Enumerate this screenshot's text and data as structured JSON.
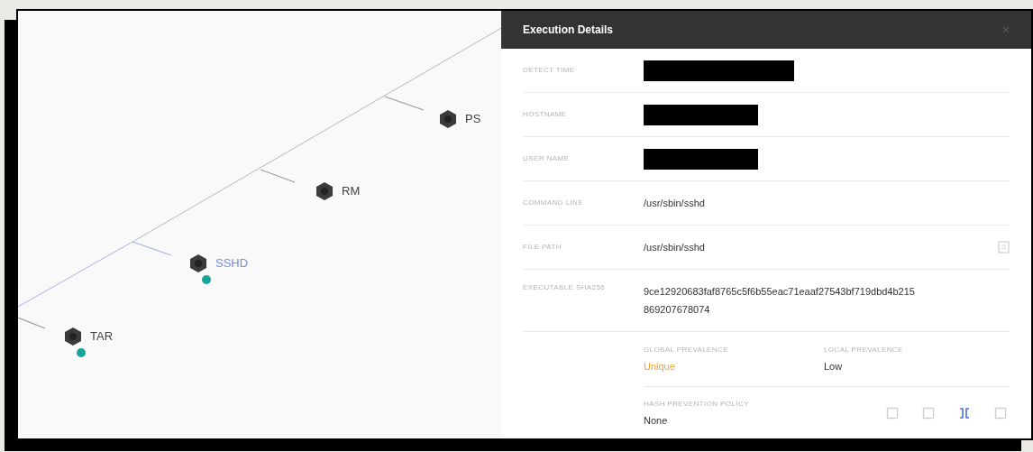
{
  "process_tree": {
    "nodes": [
      {
        "label": "PS",
        "selected": false,
        "badge": false
      },
      {
        "label": "RM",
        "selected": false,
        "badge": false
      },
      {
        "label": "SSHD",
        "selected": true,
        "badge": true
      },
      {
        "label": "TAR",
        "selected": false,
        "badge": true
      }
    ]
  },
  "execution_details": {
    "title": "Execution Details",
    "rows": [
      {
        "kind": "redacted",
        "label": "DETECT TIME"
      },
      {
        "kind": "redacted",
        "label": "HOSTNAME"
      },
      {
        "kind": "redacted",
        "label": "USER NAME"
      },
      {
        "kind": "text",
        "label": "COMMAND LINE",
        "value": "/usr/sbin/sshd"
      },
      {
        "kind": "copy",
        "label": "FILE PATH",
        "value": "/usr/sbin/sshd"
      },
      {
        "kind": "text",
        "label": "EXECUTABLE SHA256",
        "value": "9ce12920683faf8765c5f6b55eac71eaaf27543bf719dbd4b215869207678074"
      }
    ],
    "prevalence": [
      {
        "label": "GLOBAL PREVALENCE",
        "value": "Unique",
        "highlighted": true
      },
      {
        "label": "LOCAL PREVALENCE",
        "value": "Low",
        "highlighted": false
      }
    ],
    "hash_policy": {
      "label": "HASH PREVENTION POLICY",
      "value": "None",
      "actions": [
        {
          "selected": false
        },
        {
          "selected": false
        },
        {
          "selected": true
        },
        {
          "selected": false
        }
      ]
    }
  }
}
